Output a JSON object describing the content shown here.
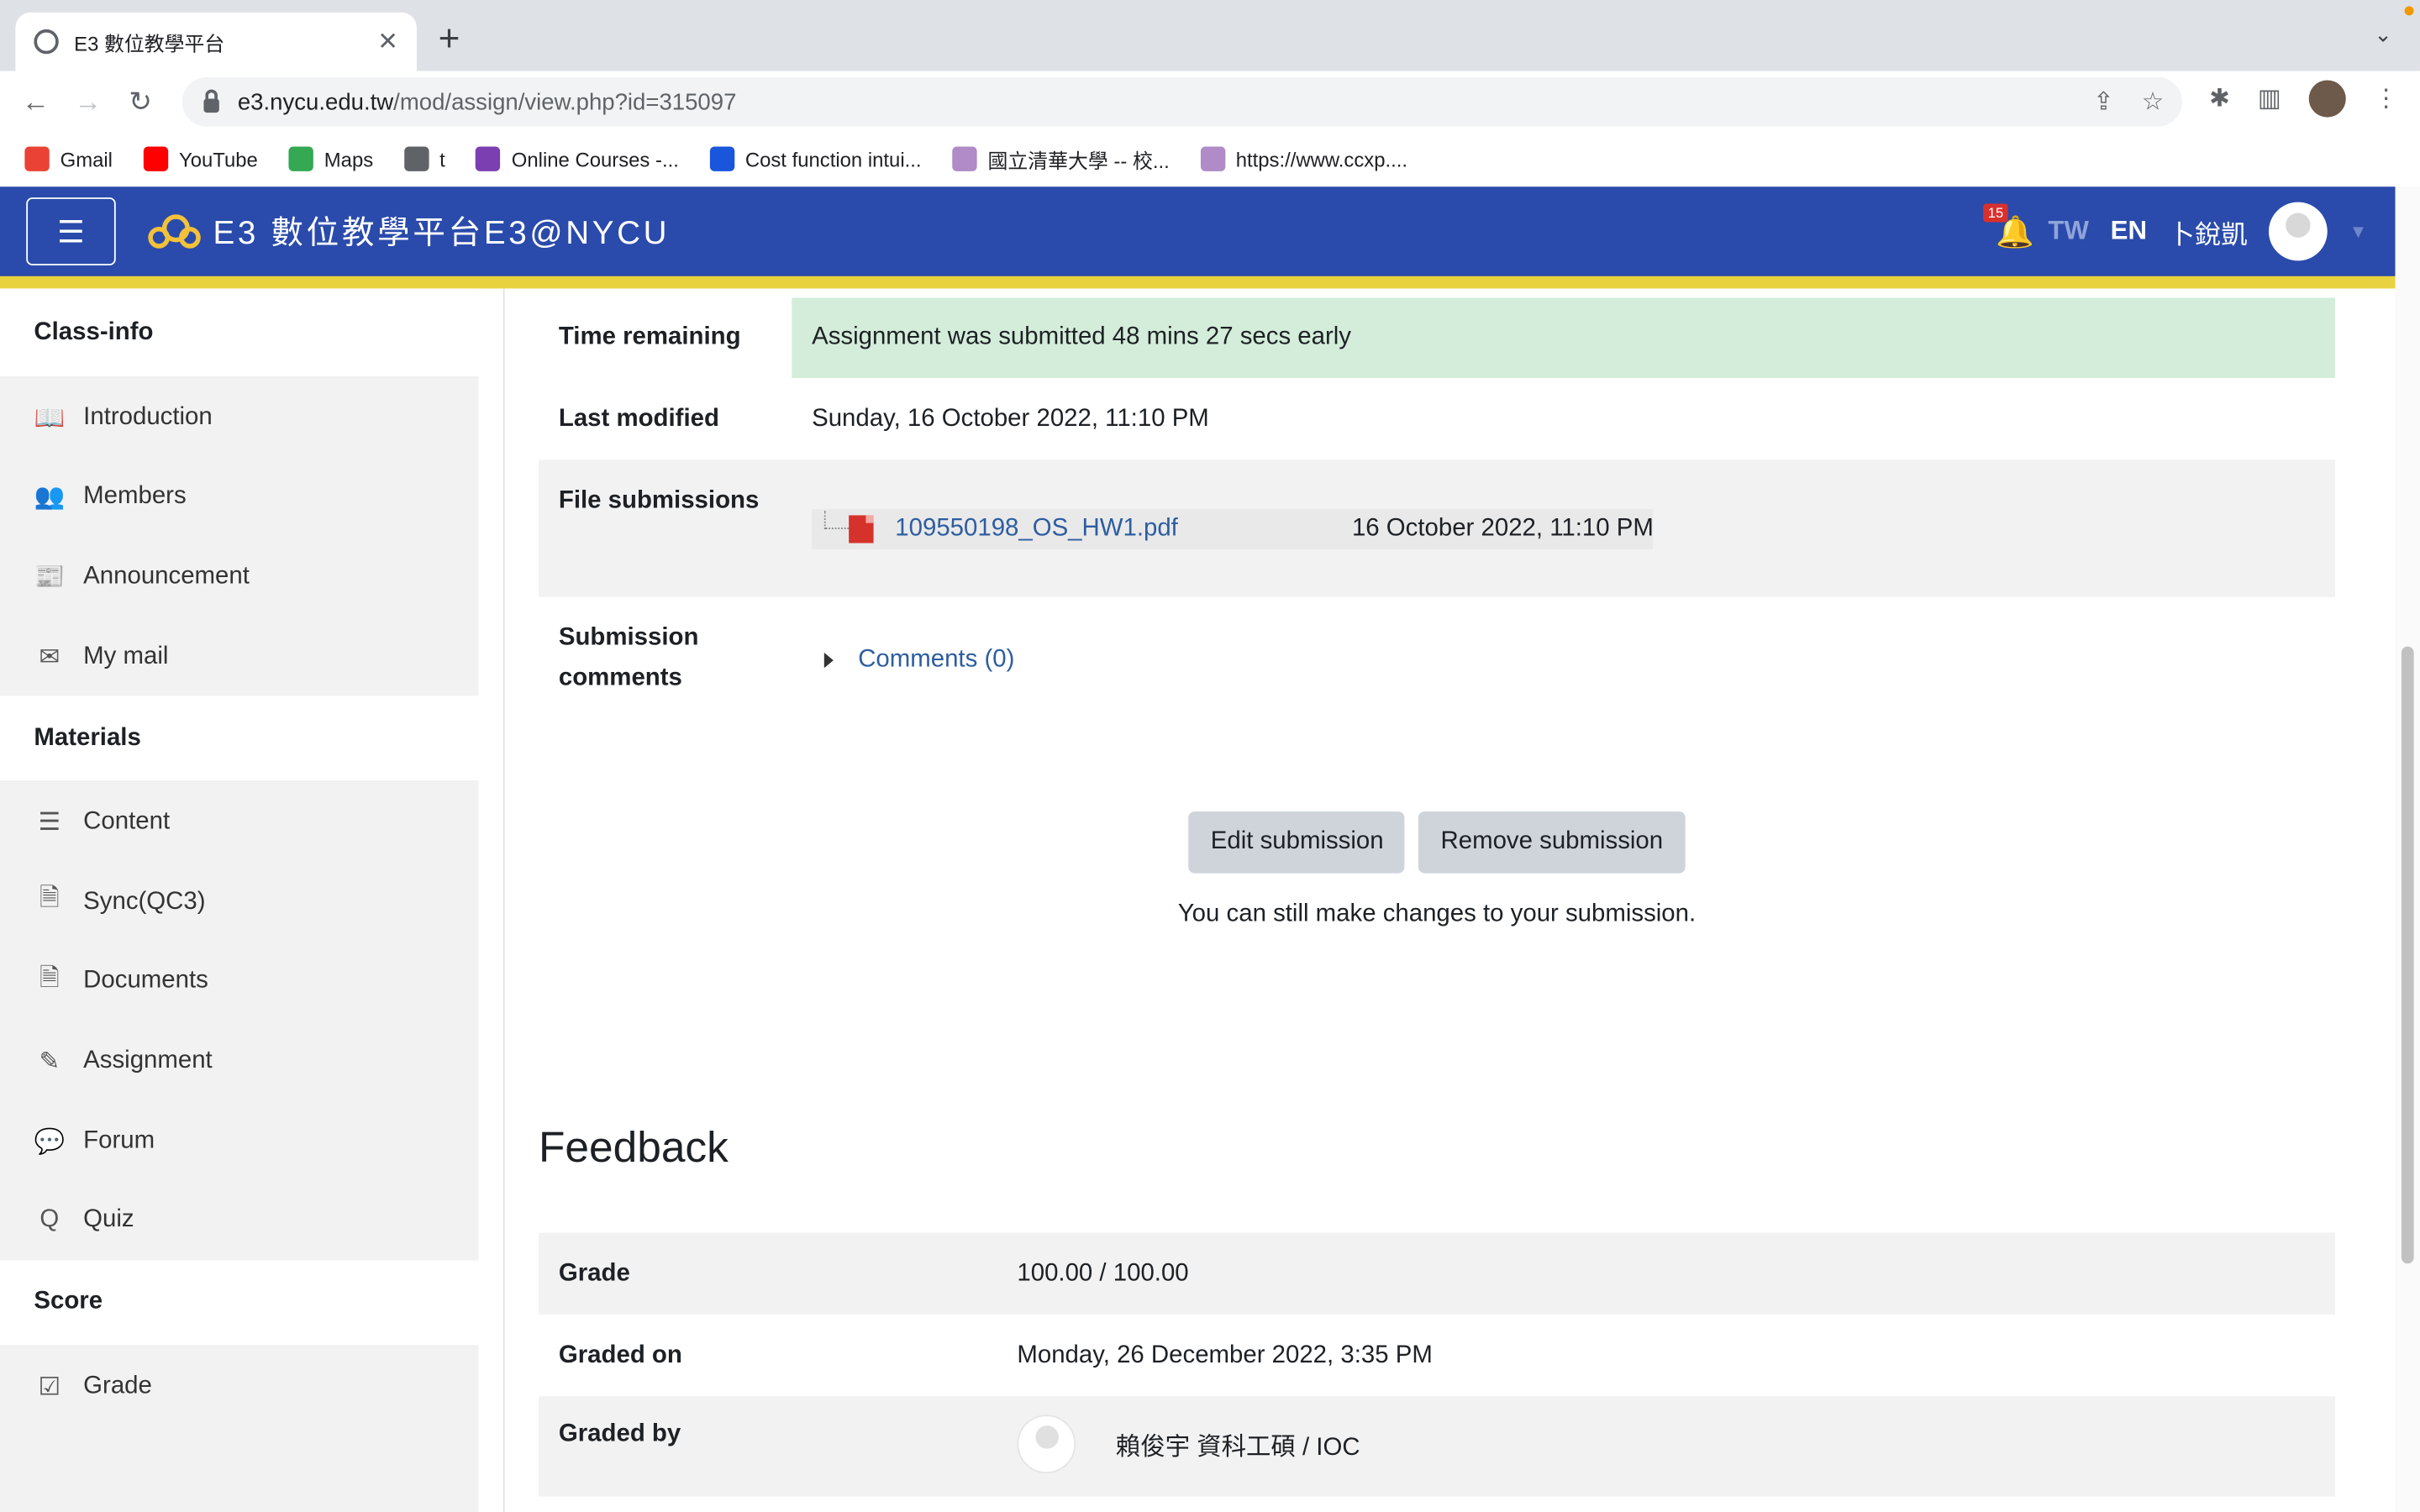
{
  "browser": {
    "tab_title": "E3 數位教學平台",
    "url_host": "e3.nycu.edu.tw",
    "url_path": "/mod/assign/view.php?id=315097",
    "bookmarks": [
      {
        "label": "Gmail",
        "color": "#ea4335"
      },
      {
        "label": "YouTube",
        "color": "#ff0000"
      },
      {
        "label": "Maps",
        "color": "#34a853"
      },
      {
        "label": "t",
        "color": "#5f6368"
      },
      {
        "label": "Online Courses -...",
        "color": "#7b3fb2"
      },
      {
        "label": "Cost function intui...",
        "color": "#1a56db"
      },
      {
        "label": "國立清華大學 -- 校...",
        "color": "#b08bc7"
      },
      {
        "label": "https://www.ccxp....",
        "color": "#b08bc7"
      }
    ]
  },
  "header": {
    "brand": "E3 數位教學平台E3@NYCU",
    "notification_count": "15",
    "lang_tw": "TW",
    "lang_en": "EN",
    "user_name": "卜銳凱",
    "colors": {
      "bar": "#2a4bab",
      "accent_line": "#e9d23f"
    }
  },
  "sidebar": {
    "sections": [
      {
        "title": "Class-info",
        "items": [
          {
            "label": "Introduction",
            "icon": "book-icon",
            "glyph": "📖"
          },
          {
            "label": "Members",
            "icon": "users-icon",
            "glyph": "👥"
          },
          {
            "label": "Announcement",
            "icon": "newspaper-icon",
            "glyph": "📰"
          },
          {
            "label": "My mail",
            "icon": "envelope-icon",
            "glyph": "✉"
          }
        ]
      },
      {
        "title": "Materials",
        "items": [
          {
            "label": "Content",
            "icon": "list-icon",
            "glyph": "☰"
          },
          {
            "label": "Sync(QC3)",
            "icon": "file-icon",
            "glyph": "🗎"
          },
          {
            "label": "Documents",
            "icon": "file-icon",
            "glyph": "🗎"
          },
          {
            "label": "Assignment",
            "icon": "edit-icon",
            "glyph": "✎"
          },
          {
            "label": "Forum",
            "icon": "comments-icon",
            "glyph": "💬"
          },
          {
            "label": "Quiz",
            "icon": "quiz-icon",
            "glyph": "Q"
          }
        ]
      },
      {
        "title": "Score",
        "items": [
          {
            "label": "Grade",
            "icon": "check-square-icon",
            "glyph": "☑"
          }
        ]
      }
    ]
  },
  "submission": {
    "time_remaining_label": "Time remaining",
    "time_remaining_value": "Assignment was submitted 48 mins 27 secs early",
    "last_modified_label": "Last modified",
    "last_modified_value": "Sunday, 16 October 2022, 11:10 PM",
    "file_submissions_label": "File submissions",
    "file_name": "109550198_OS_HW1.pdf",
    "file_date": "16 October 2022, 11:10 PM",
    "comments_label_1": "Submission",
    "comments_label_2": "comments",
    "comments_link": "Comments (0)",
    "edit_button": "Edit submission",
    "remove_button": "Remove submission",
    "help_text": "You can still make changes to your submission."
  },
  "feedback": {
    "title": "Feedback",
    "grade_label": "Grade",
    "grade_value": "100.00 / 100.00",
    "graded_on_label": "Graded on",
    "graded_on_value": "Monday, 26 December 2022, 3:35 PM",
    "graded_by_label": "Graded by",
    "graded_by_value": "賴俊宇 資科工碩 / IOC"
  }
}
